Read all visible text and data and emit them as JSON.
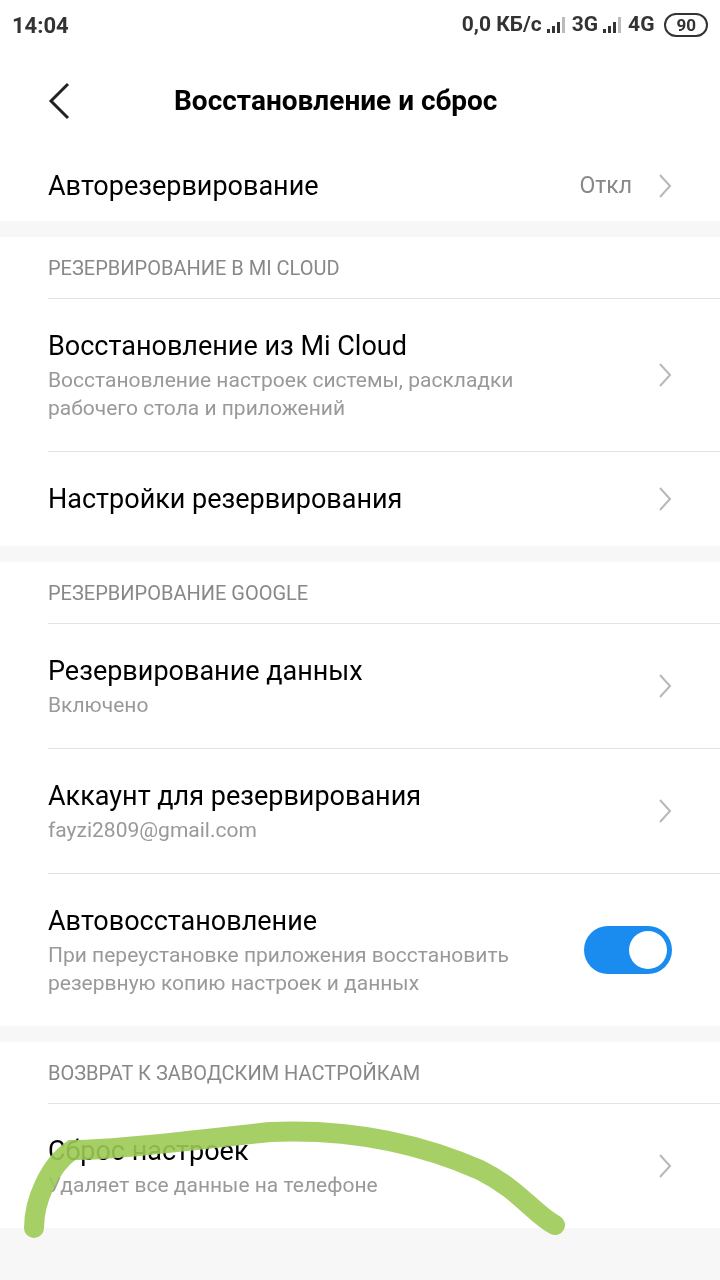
{
  "status_bar": {
    "time": "14:04",
    "speed": "0,0 КБ/с",
    "network_1": "3G",
    "network_2": "4G",
    "battery": "90"
  },
  "header": {
    "title": "Восстановление и сброс"
  },
  "sections": [
    {
      "items": [
        {
          "kind": "link",
          "title": "Авторезервирование",
          "value": "Откл"
        }
      ]
    },
    {
      "heading": "РЕЗЕРВИРОВАНИЕ В MI CLOUD",
      "items": [
        {
          "kind": "link",
          "title": "Восстановление из Mi Cloud",
          "subtitle": "Восстановление настроек системы, раскладки рабочего стола и приложений"
        },
        {
          "kind": "link",
          "title": "Настройки резервирования"
        }
      ]
    },
    {
      "heading": "РЕЗЕРВИРОВАНИЕ GOOGLE",
      "items": [
        {
          "kind": "link",
          "title": "Резервирование данных",
          "subtitle": "Включено"
        },
        {
          "kind": "link",
          "title": "Аккаунт для резервирования",
          "subtitle": "fayzi2809@gmail.com"
        },
        {
          "kind": "toggle",
          "title": "Автовосстановление",
          "subtitle": "При переустановке приложения восстановить резервную копию настроек и данных",
          "on": true
        }
      ]
    },
    {
      "heading": "ВОЗВРАТ К ЗАВОДСКИМ НАСТРОЙКАМ",
      "items": [
        {
          "kind": "link",
          "title": "Сброс настроек",
          "subtitle": "Удаляет все данные на телефоне"
        }
      ]
    }
  ]
}
